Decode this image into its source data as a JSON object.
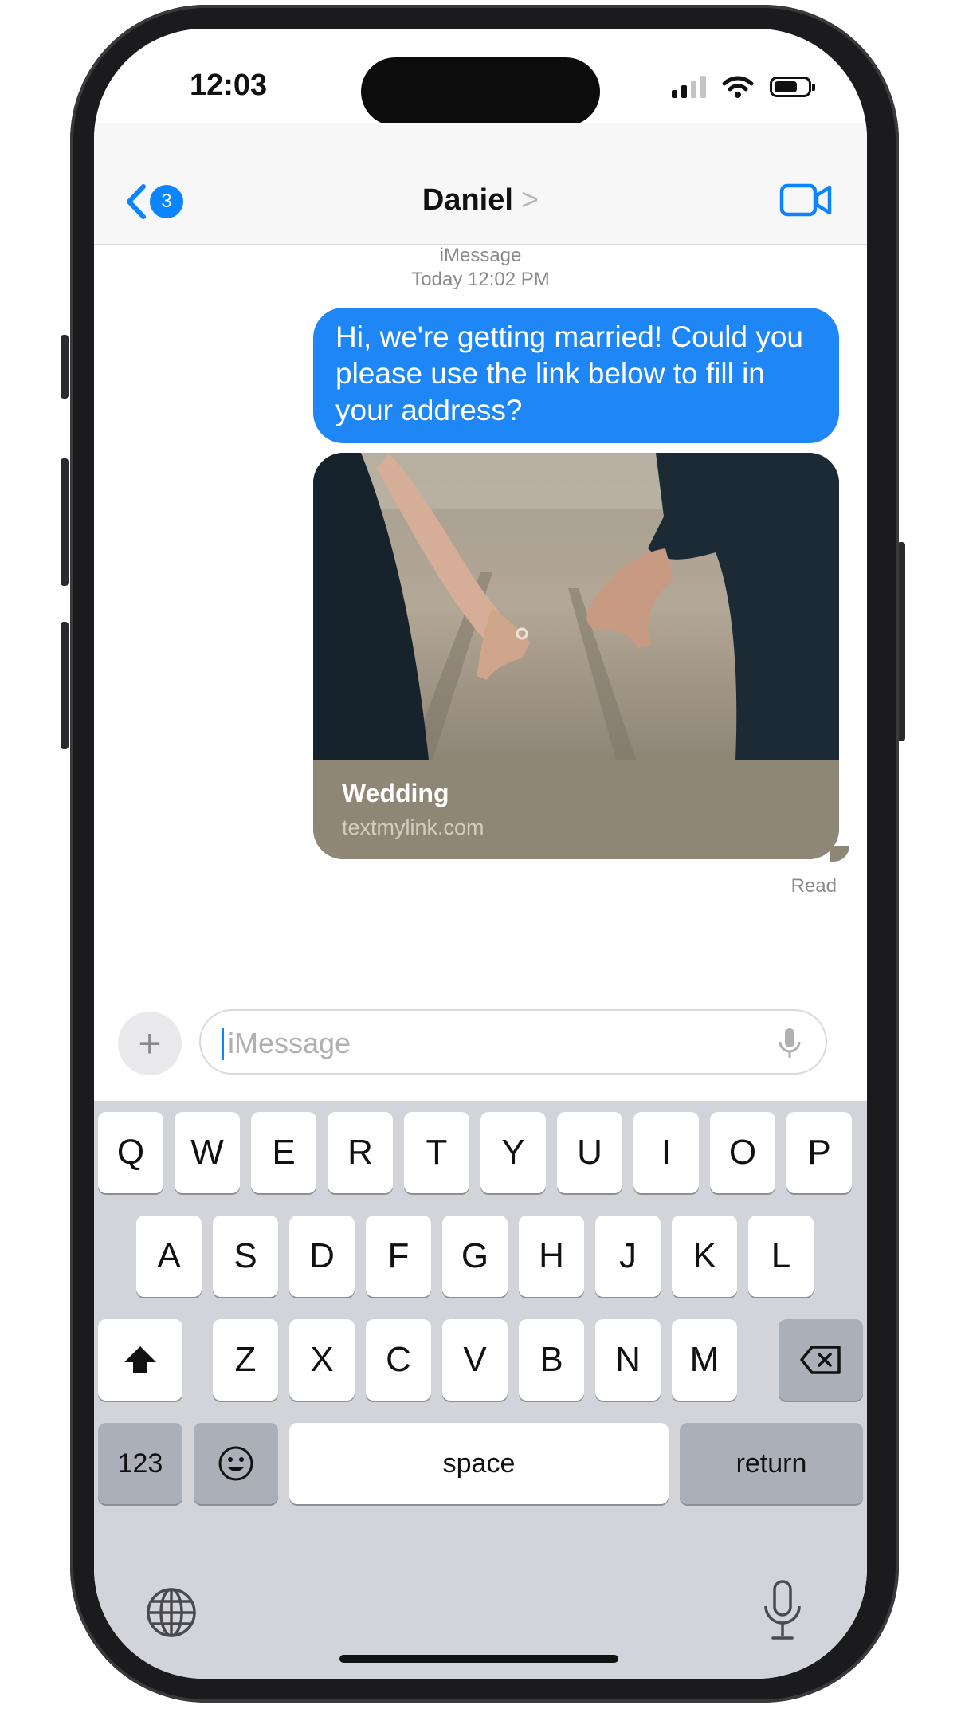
{
  "status_bar": {
    "time": "12:03"
  },
  "header": {
    "back_badge": "3",
    "contact_name": "Daniel",
    "contact_chevron": ">"
  },
  "thread": {
    "service": "iMessage",
    "timestamp": "Today 12:02 PM",
    "outgoing_message": "Hi, we're getting married! Could you please use the link below to fill in your address?",
    "link_preview": {
      "title": "Wedding",
      "domain": "textmylink.com"
    },
    "receipt": "Read"
  },
  "compose": {
    "plus_label": "+",
    "placeholder": "iMessage"
  },
  "keyboard": {
    "row1": [
      "Q",
      "W",
      "E",
      "R",
      "T",
      "Y",
      "U",
      "I",
      "O",
      "P"
    ],
    "row2": [
      "A",
      "S",
      "D",
      "F",
      "G",
      "H",
      "J",
      "K",
      "L"
    ],
    "row3": [
      "Z",
      "X",
      "C",
      "V",
      "B",
      "N",
      "M"
    ],
    "numbers_label": "123",
    "space_label": "space",
    "return_label": "return"
  },
  "icons": [
    "back-chevron-icon",
    "video-call-icon",
    "signal-icon",
    "wifi-icon",
    "battery-icon",
    "microphone-icon",
    "shift-icon",
    "delete-icon",
    "emoji-icon",
    "globe-icon",
    "dictation-mic-icon"
  ],
  "colors": {
    "accent": "#0a84ff",
    "bubble": "#1f86f5",
    "keyboard_bg": "#d2d4da",
    "link_card": "#8f8775"
  }
}
